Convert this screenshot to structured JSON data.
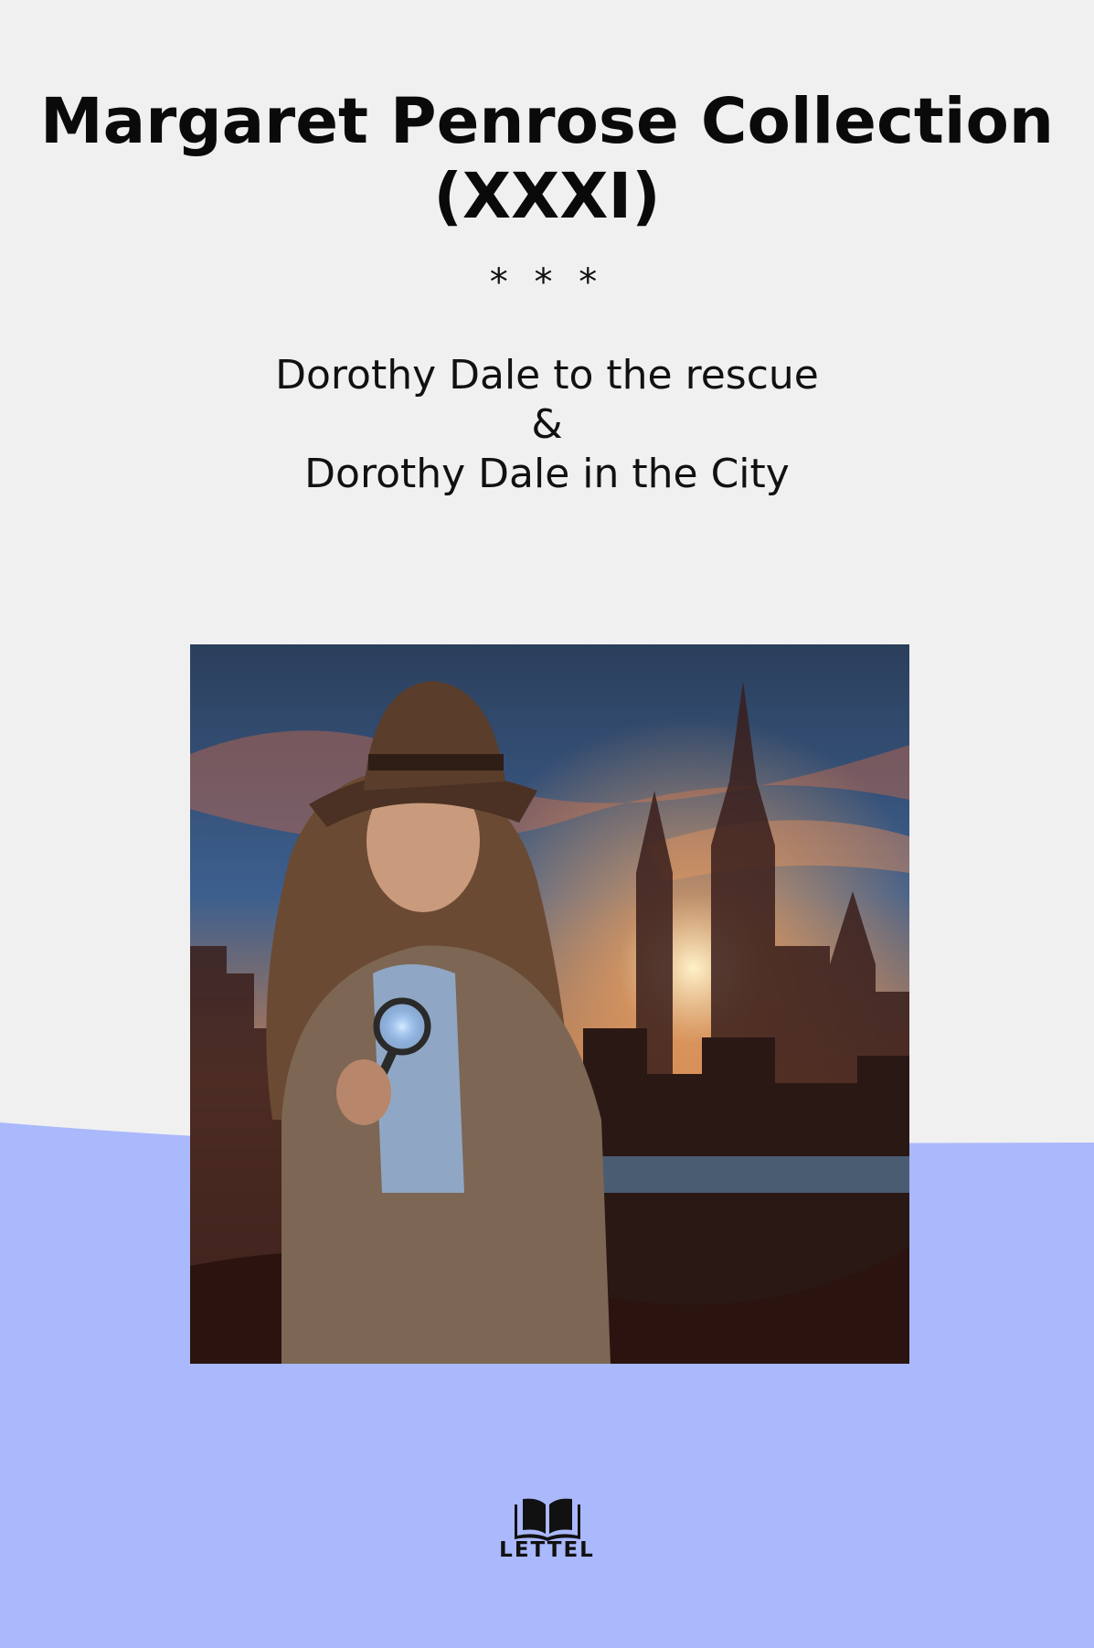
{
  "book": {
    "title_line1": "Margaret Penrose Collection",
    "title_line2": "(XXXI)",
    "separator": "* * *",
    "story1": "Dorothy Dale to the rescue",
    "conjunction": "&",
    "story2": "Dorothy Dale in the City"
  },
  "cover_image": {
    "icon": "illustration-girl-detective-city-skyline"
  },
  "publisher": {
    "name": "LETTEL",
    "icon": "open-book-icon"
  },
  "colors": {
    "background": "#f0f0f0",
    "band": "#aab8fc",
    "text": "#0a0a0a"
  }
}
